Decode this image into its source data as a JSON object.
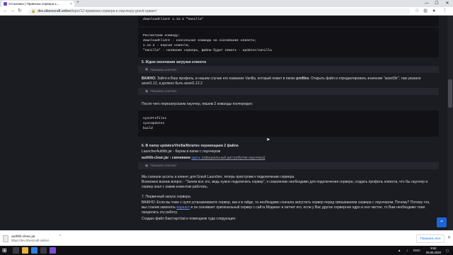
{
  "browser": {
    "tab_title": "Установка | Привязка сервера к...",
    "tab_close": "×",
    "new_tab": "+",
    "url_host": "dev.ziberscraft.online",
    "url_path": "/topic/12-привязка-сервера-к-лаунчеру-gravit-гравит/",
    "win_min": "—",
    "win_max": "☐",
    "win_close": "✕"
  },
  "content": {
    "code1_line": "downloadClient 1.12.2 \"Vanilla\"",
    "code2_lines": [
      "Рассмотрим команду:",
      "downloadClient - консольная команда на скачивание клиента;",
      "1.12.2 - версия клиента;",
      "\"Vanilla\" - название сервера, файлы будет лежать - updates/vanilla"
    ],
    "step5_heading": "5. Ждем окончания загрузки клиента",
    "hint_label": "Показать контент",
    "important_label": "ВАЖНО:",
    "important_text1": "Зайти в Ваш профиль, в нашем случае его название Vanilla, который лежит в папке ",
    "profiles_word": "profiles",
    "important_text2": ". Открыть файл и отредактировать значение \"assetDir\", там указано asset1.12, а должно быть asset1.12.2",
    "restart_text": "После чего перезапускаем лаунчер, пишем 2 команды поочередно:",
    "code3_lines": [
      "syncProfiles",
      "syncUpdates",
      "build"
    ],
    "step6_heading": "6. В папку updates/Vinilla/libraries перемещаем 2 файла",
    "step6_line1": "LauncherAuthlib.jar - берем в папке с лаунчером",
    "step6_line2_bold": "authlib-clean.jar - скачиваем ",
    "step6_link": "здесь",
    "step6_gray": " (официальный дистрибутив лаунчера)",
    "p1_line1": "Мы скачали ассеты и клиент для Gravit Launcher, теперь приступим к подключению сервера.",
    "p1_line2": "Возможно возник вопрос - \"Зачем все это, ведь нужно подключить сервер\", к сожалению необходимо для подключения сервера, создать профиль клиента, что бы лаунчер и сервер знал с каким клиентом работать.",
    "step7_heading": "7. Первичный запуск сервера.",
    "p2": "ВАЖНО: Если вы тоже с нуля устанавливаете сервер, как и в гайде, то необходимо сначала запустить сервер перед связыванием сервера с лаунчером. Почему? Потому что, мы станем заменять ",
    "p2_link": "вариант",
    "p2b": " и он скачивает оригинальный сервер с сайта Моджанг и патчит его, если у Вас другое серверное ядро и оно чистое, то Вам необходимо тоже проделать эту работу.",
    "p3": "Создаю файл Бакстарт.bat и помещаем туда следующее:"
  },
  "scroll_to_top": "⌃",
  "downloads": {
    "file_name": "authlib-clean.jar",
    "file_source": "https://dev.ziberscraft.online/...",
    "caret": "^",
    "show_all": "Показать все",
    "close": "✕"
  },
  "taskbar": {
    "start_icon": "⊞",
    "lang": "ENG",
    "time": "9:52",
    "date": "08.05.2020"
  }
}
